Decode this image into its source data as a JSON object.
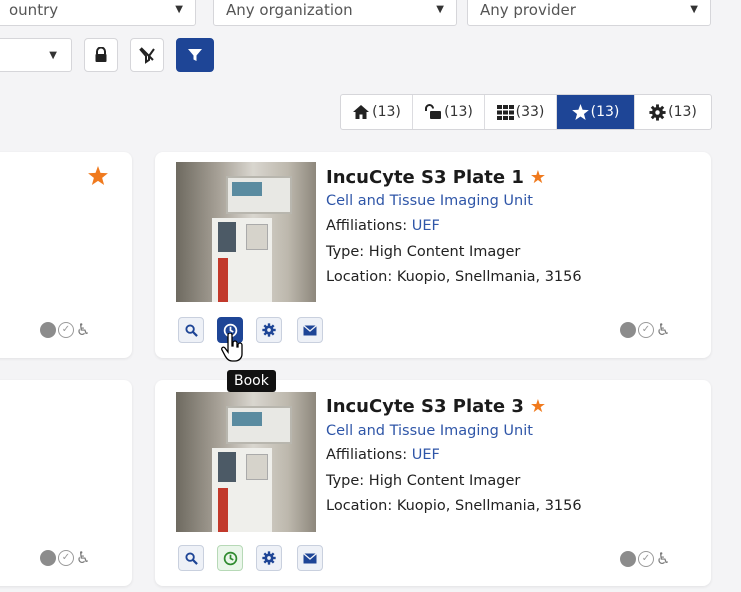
{
  "filters": {
    "country": "ountry",
    "organization": "Any organization",
    "provider": "Any provider"
  },
  "toolbar": {
    "lock_icon": "lock-icon",
    "clear_filter_icon": "filter-clear-icon",
    "filter_icon": "filter-icon"
  },
  "view_tabs": [
    {
      "icon": "home-icon",
      "count": "(13)"
    },
    {
      "icon": "unlock-icon",
      "count": "(13)"
    },
    {
      "icon": "grid-icon",
      "count": "(33)"
    },
    {
      "icon": "star-icon",
      "count": "(13)",
      "active": true
    },
    {
      "icon": "gear-icon",
      "count": "(13)"
    }
  ],
  "cards": [
    {
      "title": "IncuCyte S3 Plate 1",
      "unit": "Cell and Tissue Imaging Unit",
      "affiliations_label": "Affiliations:",
      "affiliations_value": "UEF",
      "type": "Type: High Content Imager",
      "location": "Location: Kuopio, Snellmania, 3156"
    },
    {
      "title": "IncuCyte S3 Plate 3",
      "unit": "Cell and Tissue Imaging Unit",
      "affiliations_label": "Affiliations:",
      "affiliations_value": "UEF",
      "type": "Type: High Content Imager",
      "location": "Location: Kuopio, Snellmania, 3156"
    }
  ],
  "tooltip": "Book",
  "colors": {
    "accent": "#1e4596",
    "star": "#f07a1e",
    "link": "#2f56a8"
  }
}
